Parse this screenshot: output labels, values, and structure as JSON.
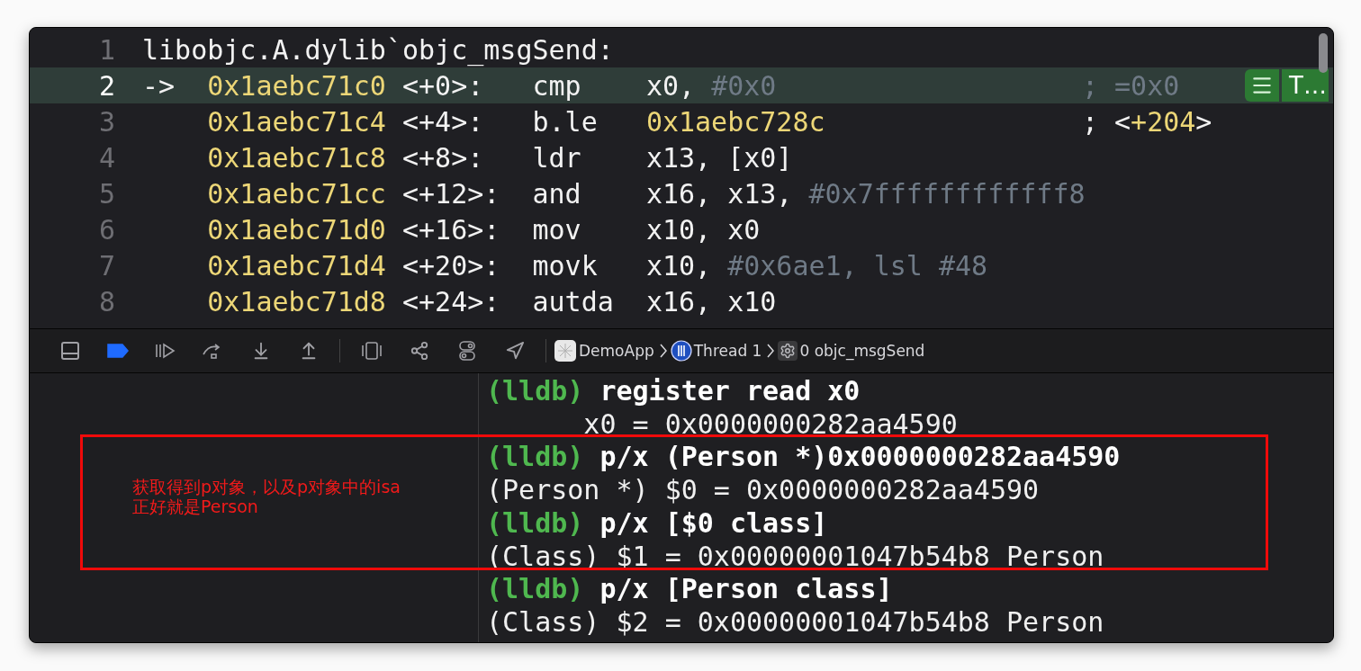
{
  "disassembly": {
    "lines": [
      {
        "number": "1",
        "selected": false,
        "kind": "label",
        "text": "libobjc.A.dylib`objc_msgSend:"
      },
      {
        "number": "2",
        "selected": true,
        "kind": "instruction",
        "marker": "->",
        "address": "0x1aebc71c0",
        "offset": "<+0>:",
        "mnemonic": "cmp",
        "operands": [
          {
            "text": "x0, ",
            "kind": "reg"
          },
          {
            "text": "#0x0",
            "kind": "imm"
          }
        ],
        "comment": [
          {
            "text": "; =0x0",
            "kind": "dim"
          }
        ]
      },
      {
        "number": "3",
        "selected": false,
        "kind": "instruction",
        "address": "0x1aebc71c4",
        "offset": "<+4>:",
        "mnemonic": "b.le",
        "operands": [
          {
            "text": "0x1aebc728c",
            "kind": "addr"
          }
        ],
        "comment": [
          {
            "text": "; <",
            "kind": "plain"
          },
          {
            "text": "+204",
            "kind": "addr"
          },
          {
            "text": ">",
            "kind": "plain"
          }
        ]
      },
      {
        "number": "4",
        "selected": false,
        "kind": "instruction",
        "address": "0x1aebc71c8",
        "offset": "<+8>:",
        "mnemonic": "ldr",
        "operands": [
          {
            "text": "x13, [x0]",
            "kind": "reg"
          }
        ]
      },
      {
        "number": "5",
        "selected": false,
        "kind": "instruction",
        "address": "0x1aebc71cc",
        "offset": "<+12>:",
        "mnemonic": "and",
        "operands": [
          {
            "text": "x16, x13, ",
            "kind": "reg"
          },
          {
            "text": "#0x7ffffffffffff8",
            "kind": "imm"
          }
        ]
      },
      {
        "number": "6",
        "selected": false,
        "kind": "instruction",
        "address": "0x1aebc71d0",
        "offset": "<+16>:",
        "mnemonic": "mov",
        "operands": [
          {
            "text": "x10, x0",
            "kind": "reg"
          }
        ]
      },
      {
        "number": "7",
        "selected": false,
        "kind": "instruction",
        "address": "0x1aebc71d4",
        "offset": "<+20>:",
        "mnemonic": "movk",
        "operands": [
          {
            "text": "x10, ",
            "kind": "reg"
          },
          {
            "text": "#0x6ae1, lsl #48",
            "kind": "imm"
          }
        ]
      },
      {
        "number": "8",
        "selected": false,
        "kind": "instruction",
        "address": "0x1aebc71d8",
        "offset": "<+24>:",
        "mnemonic": "autda",
        "operands": [
          {
            "text": "x16, x10",
            "kind": "reg"
          }
        ]
      }
    ],
    "row_button": "T…"
  },
  "debug_bar": {
    "breakpoints_active": true,
    "breadcrumbs": [
      {
        "kind": "app",
        "label": "DemoApp"
      },
      {
        "kind": "thread",
        "label": "Thread 1"
      },
      {
        "kind": "frame",
        "label": "0 objc_msgSend"
      }
    ]
  },
  "console": {
    "lines": [
      {
        "kind": "command",
        "prompt": "(lldb)",
        "text": "register read x0"
      },
      {
        "kind": "output",
        "text": "      x0 = 0x0000000282aa4590"
      },
      {
        "kind": "command",
        "prompt": "(lldb)",
        "text": "p/x (Person *)0x0000000282aa4590"
      },
      {
        "kind": "output",
        "text": "(Person *) $0 = 0x0000000282aa4590"
      },
      {
        "kind": "command",
        "prompt": "(lldb)",
        "text": "p/x [$0 class]"
      },
      {
        "kind": "output",
        "text": "(Class) $1 = 0x00000001047b54b8 Person"
      },
      {
        "kind": "command",
        "prompt": "(lldb)",
        "text": "p/x [Person class]"
      },
      {
        "kind": "output",
        "text": "(Class) $2 = 0x00000001047b54b8 Person"
      }
    ]
  },
  "annotation": {
    "lines": [
      "获取得到p对象，以及p对象中的isa",
      "正好就是Person"
    ]
  }
}
